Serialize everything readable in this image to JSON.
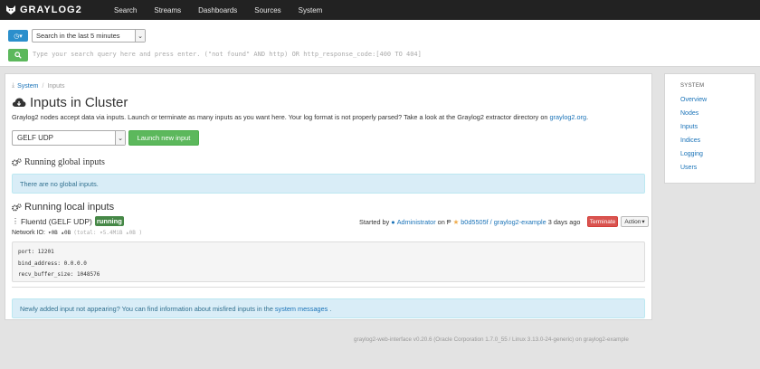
{
  "navbar": {
    "brand": "GRAYLOG2",
    "items": [
      "Search",
      "Streams",
      "Dashboards",
      "Sources",
      "System"
    ]
  },
  "search": {
    "range": "Search in the last 5 minutes",
    "query_placeholder": "Type your search query here and press enter. (\"not found\" AND http) OR http_response_code:[400 TO 404]"
  },
  "breadcrumb": {
    "root": "System",
    "sep": "/",
    "current": "Inputs"
  },
  "page": {
    "title": "Inputs in Cluster",
    "desc_prefix": "Graylog2 nodes accept data via inputs. Launch or terminate as many inputs as you want here. Your log format is not properly parsed? Take a look at the Graylog2 extractor directory on",
    "desc_link": "graylog2.org",
    "desc_suffix": ".",
    "input_type": "GELF UDP",
    "launch_label": "Launch new input"
  },
  "global": {
    "heading": "Running global inputs",
    "empty": "There are no global inputs."
  },
  "local": {
    "heading": "Running local inputs",
    "input_name": "Fluentd (GELF UDP)",
    "status": "running",
    "started_prefix": "Started by",
    "started_user": "Administrator",
    "started_on": "on",
    "node": "b0d5505f / graylog2-example",
    "age": "3 days ago",
    "terminate_label": "Terminate",
    "action_label": "Action",
    "network_label": "Network IO:",
    "network_now": "▾0B ▴0B",
    "network_total": "(total: ▾5.4MiB ▴0B )",
    "config": [
      "port: 12201",
      "bind_address: 0.0.0.0",
      "recv_buffer_size: 1048576"
    ]
  },
  "notice": {
    "prefix": "Newly added input not appearing? You can find information about misfired inputs in the",
    "link": "system messages",
    "suffix": "."
  },
  "sidebar": {
    "heading": "SYSTEM",
    "items": [
      "Overview",
      "Nodes",
      "Inputs",
      "Indices",
      "Logging",
      "Users"
    ]
  },
  "footer": "graylog2-web-interface v0.20.6 (Oracle Corporation 1.7.0_55 / Linux 3.13.0-24-generic) on graylog2-example",
  "colors": {
    "navbar": "#222222",
    "accent": "#1a73b8",
    "success": "#5cb85c",
    "danger": "#d9534f",
    "info_bg": "#d9edf7"
  }
}
